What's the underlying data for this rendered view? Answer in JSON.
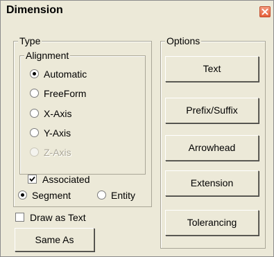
{
  "window": {
    "title": "Dimension",
    "close_icon": "close-icon"
  },
  "type_group": {
    "legend": "Type",
    "alignment": {
      "legend": "Alignment",
      "options": [
        {
          "label": "Automatic",
          "selected": true,
          "enabled": true
        },
        {
          "label": "FreeForm",
          "selected": false,
          "enabled": true
        },
        {
          "label": "X-Axis",
          "selected": false,
          "enabled": true
        },
        {
          "label": "Y-Axis",
          "selected": false,
          "enabled": true
        },
        {
          "label": "Z-Axis",
          "selected": false,
          "enabled": false
        }
      ]
    },
    "associated": {
      "label": "Associated",
      "checked": true
    },
    "segment": {
      "label": "Segment",
      "selected": true
    },
    "entity": {
      "label": "Entity",
      "selected": false
    }
  },
  "draw_as_text": {
    "label": "Draw as Text",
    "checked": false
  },
  "same_as_button": {
    "label": "Same As"
  },
  "options_group": {
    "legend": "Options",
    "buttons": [
      {
        "label": "Text"
      },
      {
        "label": "Prefix/Suffix"
      },
      {
        "label": "Arrowhead"
      },
      {
        "label": "Extension"
      },
      {
        "label": "Tolerancing"
      }
    ]
  }
}
